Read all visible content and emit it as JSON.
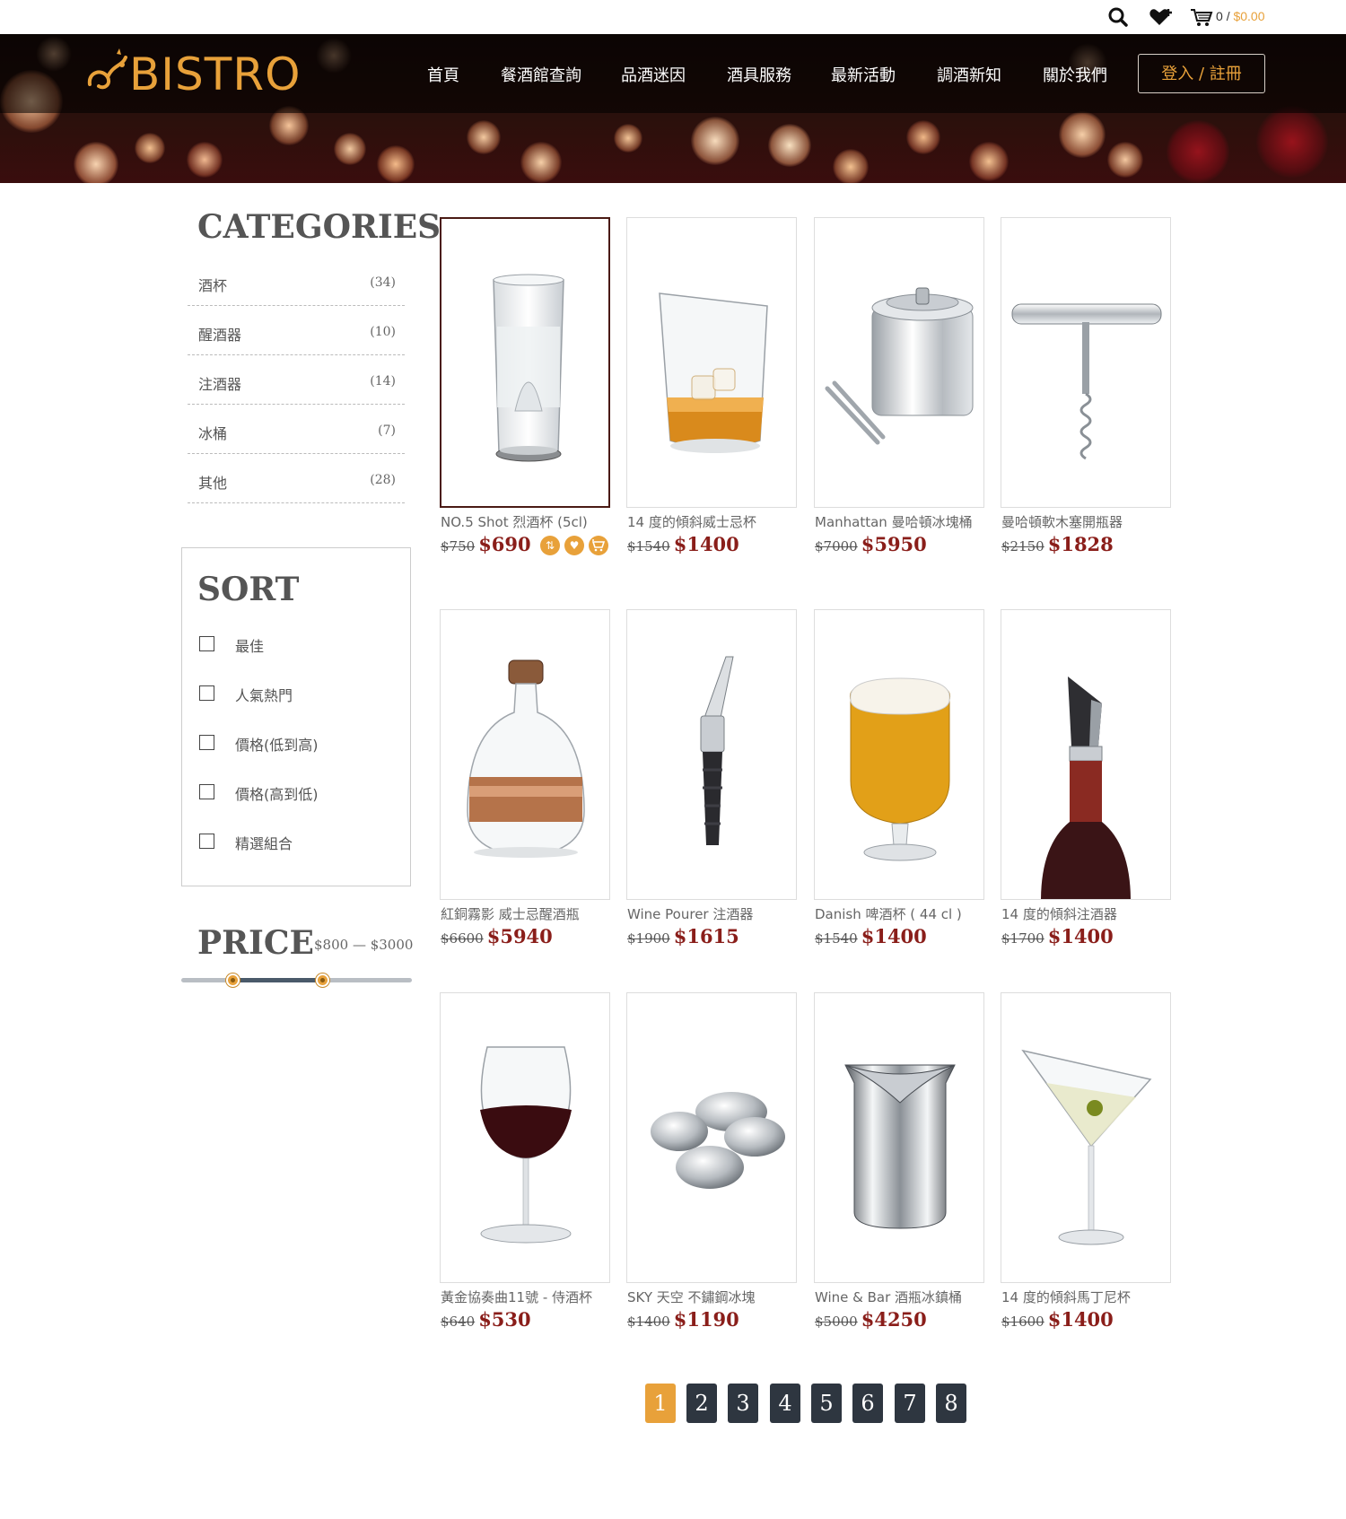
{
  "topbar": {
    "cart_count": "0",
    "cart_separator": "/",
    "cart_total": "$0.00"
  },
  "brand": {
    "logo_text": "BISTRO"
  },
  "nav": {
    "items": [
      "首頁",
      "餐酒館查詢",
      "品酒迷因",
      "酒具服務",
      "最新活動",
      "調酒新知",
      "關於我們"
    ],
    "login": "登入 / 註冊"
  },
  "categories": {
    "title": "CATEGORIES",
    "items": [
      {
        "name": "酒杯",
        "count": "(34)"
      },
      {
        "name": "醒酒器",
        "count": "(10)"
      },
      {
        "name": "注酒器",
        "count": "(14)"
      },
      {
        "name": "冰桶",
        "count": "(7)"
      },
      {
        "name": "其他",
        "count": "(28)"
      }
    ]
  },
  "sort": {
    "title": "SORT",
    "options": [
      "最佳",
      "人氣熱門",
      "價格(低到高)",
      "價格(高到低)",
      "精選組合"
    ]
  },
  "price_filter": {
    "title": "PRICE",
    "range_label": "$800 — $3000",
    "min_fraction": 0.22,
    "max_fraction": 0.61
  },
  "products": [
    {
      "name": "NO.5 Shot 烈酒杯 (5cl)",
      "old_price": "$750",
      "price": "$690"
    },
    {
      "name": "14 度的傾斜威士忌杯",
      "old_price": "$1540",
      "price": "$1400"
    },
    {
      "name": "Manhattan 曼哈頓冰塊桶",
      "old_price": "$7000",
      "price": "$5950"
    },
    {
      "name": "曼哈頓軟木塞開瓶器",
      "old_price": "$2150",
      "price": "$1828"
    },
    {
      "name": "紅銅霧影 威士忌醒酒瓶",
      "old_price": "$6600",
      "price": "$5940"
    },
    {
      "name": "Wine Pourer 注酒器",
      "old_price": "$1900",
      "price": "$1615"
    },
    {
      "name": "Danish 啤酒杯 ( 44 cl )",
      "old_price": "$1540",
      "price": "$1400"
    },
    {
      "name": "14 度的傾斜注酒器",
      "old_price": "$1700",
      "price": "$1400"
    },
    {
      "name": "黃金協奏曲11號 - 侍酒杯",
      "old_price": "$640",
      "price": "$530"
    },
    {
      "name": "SKY 天空 不鏽鋼冰塊",
      "old_price": "$1400",
      "price": "$1190"
    },
    {
      "name": "Wine & Bar 酒瓶冰鎮桶",
      "old_price": "$5000",
      "price": "$4250"
    },
    {
      "name": "14 度的傾斜馬丁尼杯",
      "old_price": "$1600",
      "price": "$1400"
    }
  ],
  "card_actions": [
    "compare-icon",
    "heart-icon",
    "cart-icon"
  ],
  "pagination": {
    "pages": [
      "1",
      "2",
      "3",
      "4",
      "5",
      "6",
      "7",
      "8"
    ],
    "current": "1"
  },
  "colors": {
    "accent": "#e8a13a",
    "price": "#8a1e1a",
    "pager": "#2e3640"
  }
}
